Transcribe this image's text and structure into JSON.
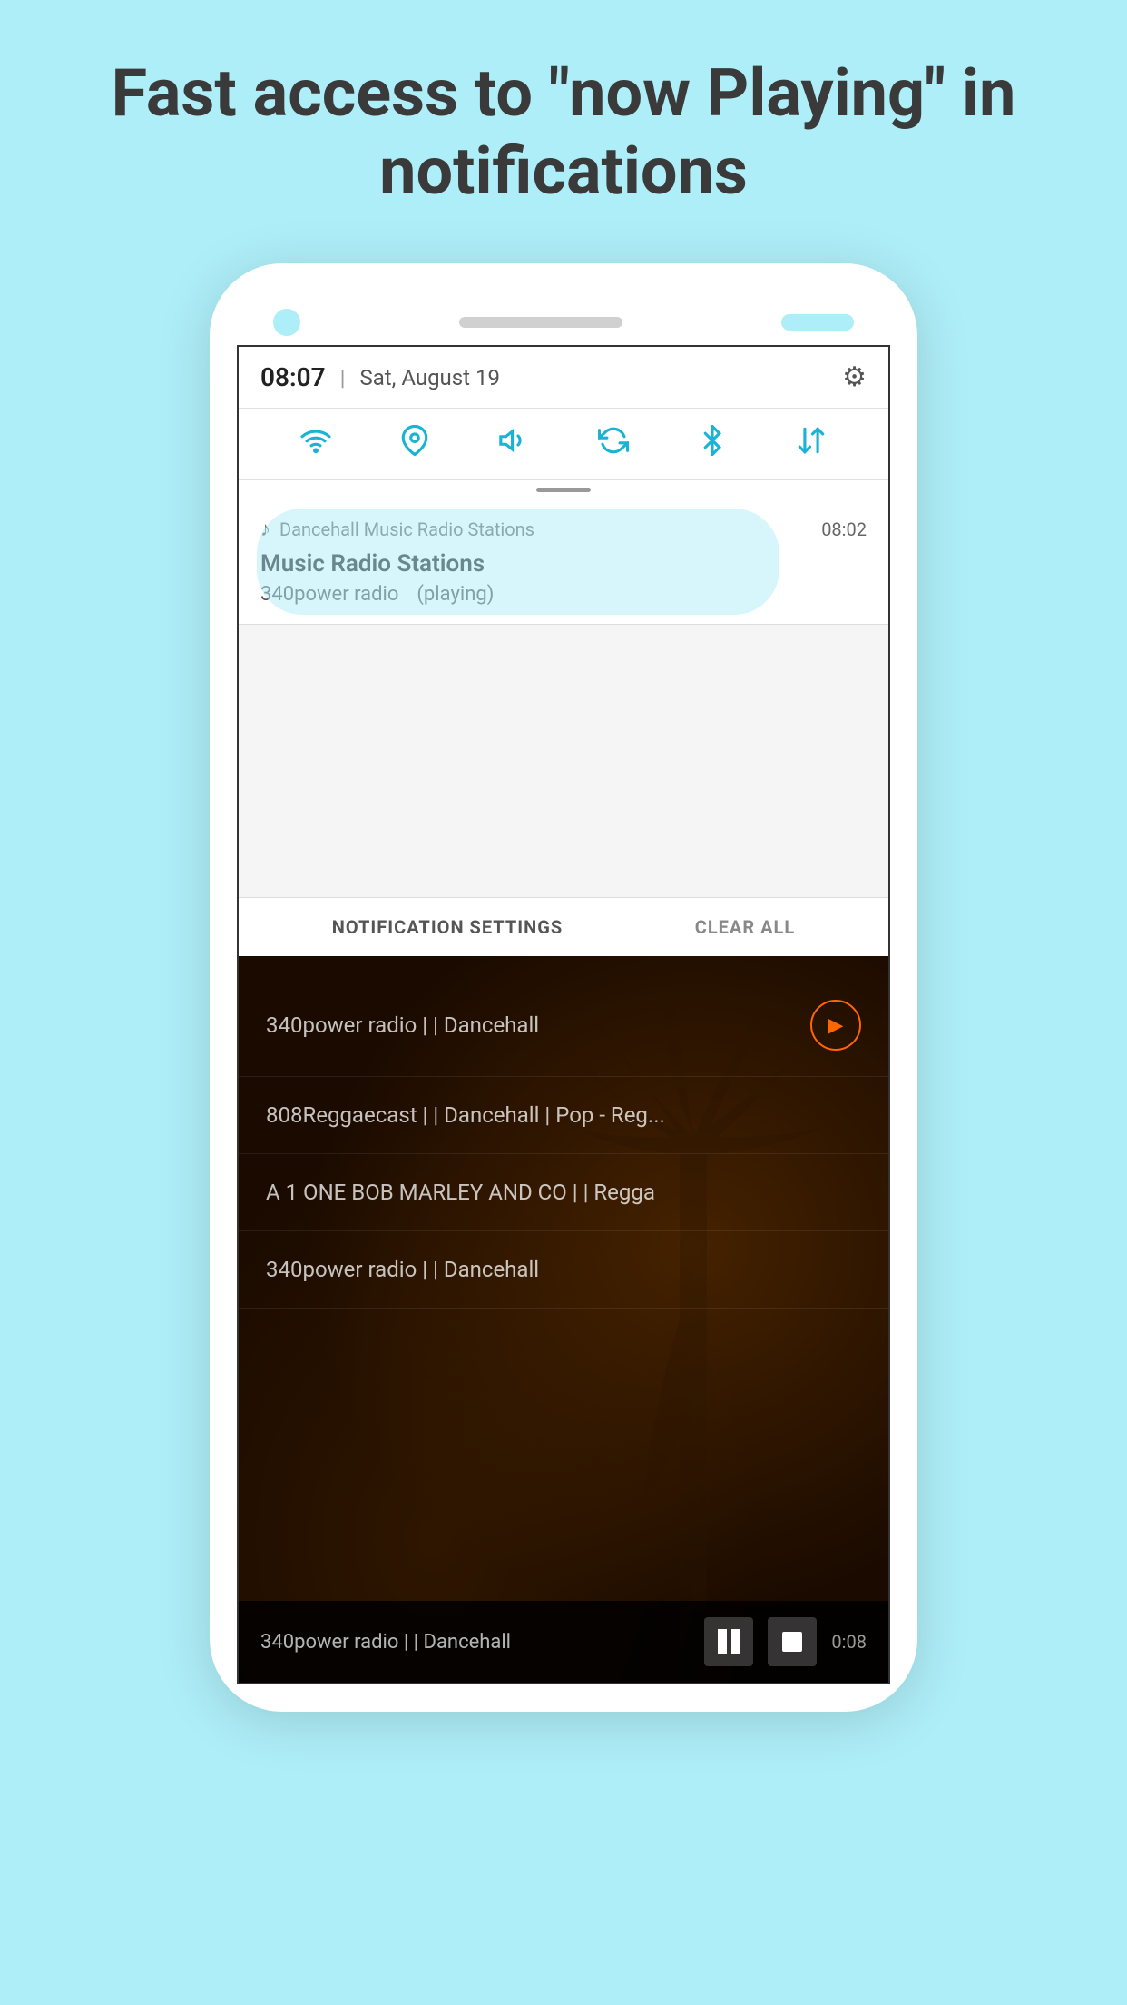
{
  "hero": {
    "title": "Fast access to \"now Playing\" in notifications"
  },
  "status_bar": {
    "time": "08:07",
    "divider": "|",
    "date": "Sat, August 19"
  },
  "notification": {
    "app_name": "Dancehall Music Radio Stations",
    "time": "08:02",
    "title": "Music Radio Stations",
    "station": "340power radio",
    "status": "(playing)"
  },
  "bottom_bar": {
    "settings_label": "NOTIFICATION SETTINGS",
    "clear_label": "CLEAR ALL"
  },
  "radio_list": {
    "items": [
      {
        "label": "340power radio | | Dancehall",
        "playing": true
      },
      {
        "label": "808Reggaecast | | Dancehall | Pop - Reg...",
        "playing": false
      },
      {
        "label": "A 1 ONE BOB MARLEY AND CO | | Regga",
        "playing": false
      },
      {
        "label": "340power radio | | Dancehall",
        "playing": false
      }
    ]
  },
  "playback": {
    "station": "340power radio | | Dancehall",
    "time": "0:08"
  },
  "icons": {
    "wifi": "wifi-icon",
    "location": "location-icon",
    "volume": "volume-icon",
    "sync": "sync-icon",
    "bluetooth": "bluetooth-icon",
    "arrows": "arrows-icon",
    "gear": "⚙",
    "music_note": "♪"
  }
}
